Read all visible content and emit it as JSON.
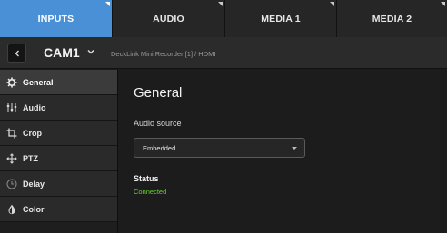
{
  "tabs": [
    {
      "label": "INPUTS",
      "active": true
    },
    {
      "label": "AUDIO",
      "active": false
    },
    {
      "label": "MEDIA 1",
      "active": false
    },
    {
      "label": "MEDIA 2",
      "active": false
    }
  ],
  "header": {
    "title": "CAM1",
    "device": "DeckLink Mini Recorder [1] / HDMI"
  },
  "sidebar": {
    "items": [
      {
        "label": "General",
        "icon": "gear-icon",
        "active": true
      },
      {
        "label": "Audio",
        "icon": "sliders-icon",
        "active": false
      },
      {
        "label": "Crop",
        "icon": "crop-icon",
        "active": false
      },
      {
        "label": "PTZ",
        "icon": "move-arrows-icon",
        "active": false
      },
      {
        "label": "Delay",
        "icon": "clock-icon",
        "active": false
      },
      {
        "label": "Color",
        "icon": "droplet-icon",
        "active": false
      }
    ]
  },
  "main": {
    "title": "General",
    "audio_source": {
      "label": "Audio source",
      "value": "Embedded"
    },
    "status": {
      "label": "Status",
      "value": "Connected"
    }
  },
  "colors": {
    "accent": "#4a90d6",
    "status_ok": "#6ccf3a"
  }
}
